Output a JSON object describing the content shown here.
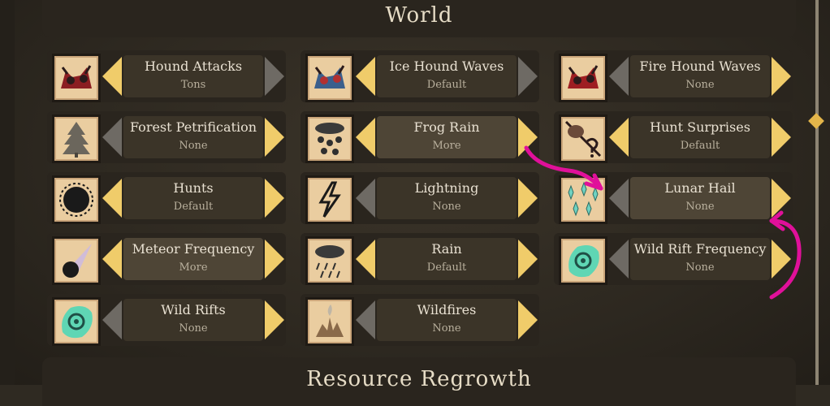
{
  "header": {
    "title": "World"
  },
  "footer": {
    "title": "Resource Regrowth"
  },
  "options": [
    {
      "label": "Hound Attacks",
      "value": "Tons",
      "icon": "hound-icon",
      "left": "on",
      "right": "off"
    },
    {
      "label": "Ice Hound Waves",
      "value": "Default",
      "icon": "ice-hound-icon",
      "left": "on",
      "right": "off"
    },
    {
      "label": "Fire Hound Waves",
      "value": "None",
      "icon": "fire-hound-icon",
      "left": "off",
      "right": "on"
    },
    {
      "label": "Forest Petrification",
      "value": "None",
      "icon": "petrified-tree-icon",
      "left": "off",
      "right": "on"
    },
    {
      "label": "Frog Rain",
      "value": "More",
      "icon": "frog-rain-icon",
      "left": "on",
      "right": "on"
    },
    {
      "label": "Hunt Surprises",
      "value": "Default",
      "icon": "hunt-surprise-icon",
      "left": "on",
      "right": "on"
    },
    {
      "label": "Hunts",
      "value": "Default",
      "icon": "hunt-track-icon",
      "left": "on",
      "right": "on"
    },
    {
      "label": "Lightning",
      "value": "None",
      "icon": "lightning-icon",
      "left": "off",
      "right": "on"
    },
    {
      "label": "Lunar Hail",
      "value": "None",
      "icon": "lunar-hail-icon",
      "left": "off",
      "right": "on"
    },
    {
      "label": "Meteor Frequency",
      "value": "More",
      "icon": "meteor-icon",
      "left": "on",
      "right": "on"
    },
    {
      "label": "Rain",
      "value": "Default",
      "icon": "rain-icon",
      "left": "on",
      "right": "on"
    },
    {
      "label": "Wild Rift Frequency",
      "value": "None",
      "icon": "rift-icon",
      "left": "off",
      "right": "on"
    },
    {
      "label": "Wild Rifts",
      "value": "None",
      "icon": "rift-icon",
      "left": "off",
      "right": "on"
    },
    {
      "label": "Wildfires",
      "value": "None",
      "icon": "wildfire-icon",
      "left": "off",
      "right": "on"
    }
  ],
  "colors": {
    "arrow_on": "#f0cc6a",
    "arrow_off": "#6e6a64",
    "annotation": "#e0109a"
  }
}
